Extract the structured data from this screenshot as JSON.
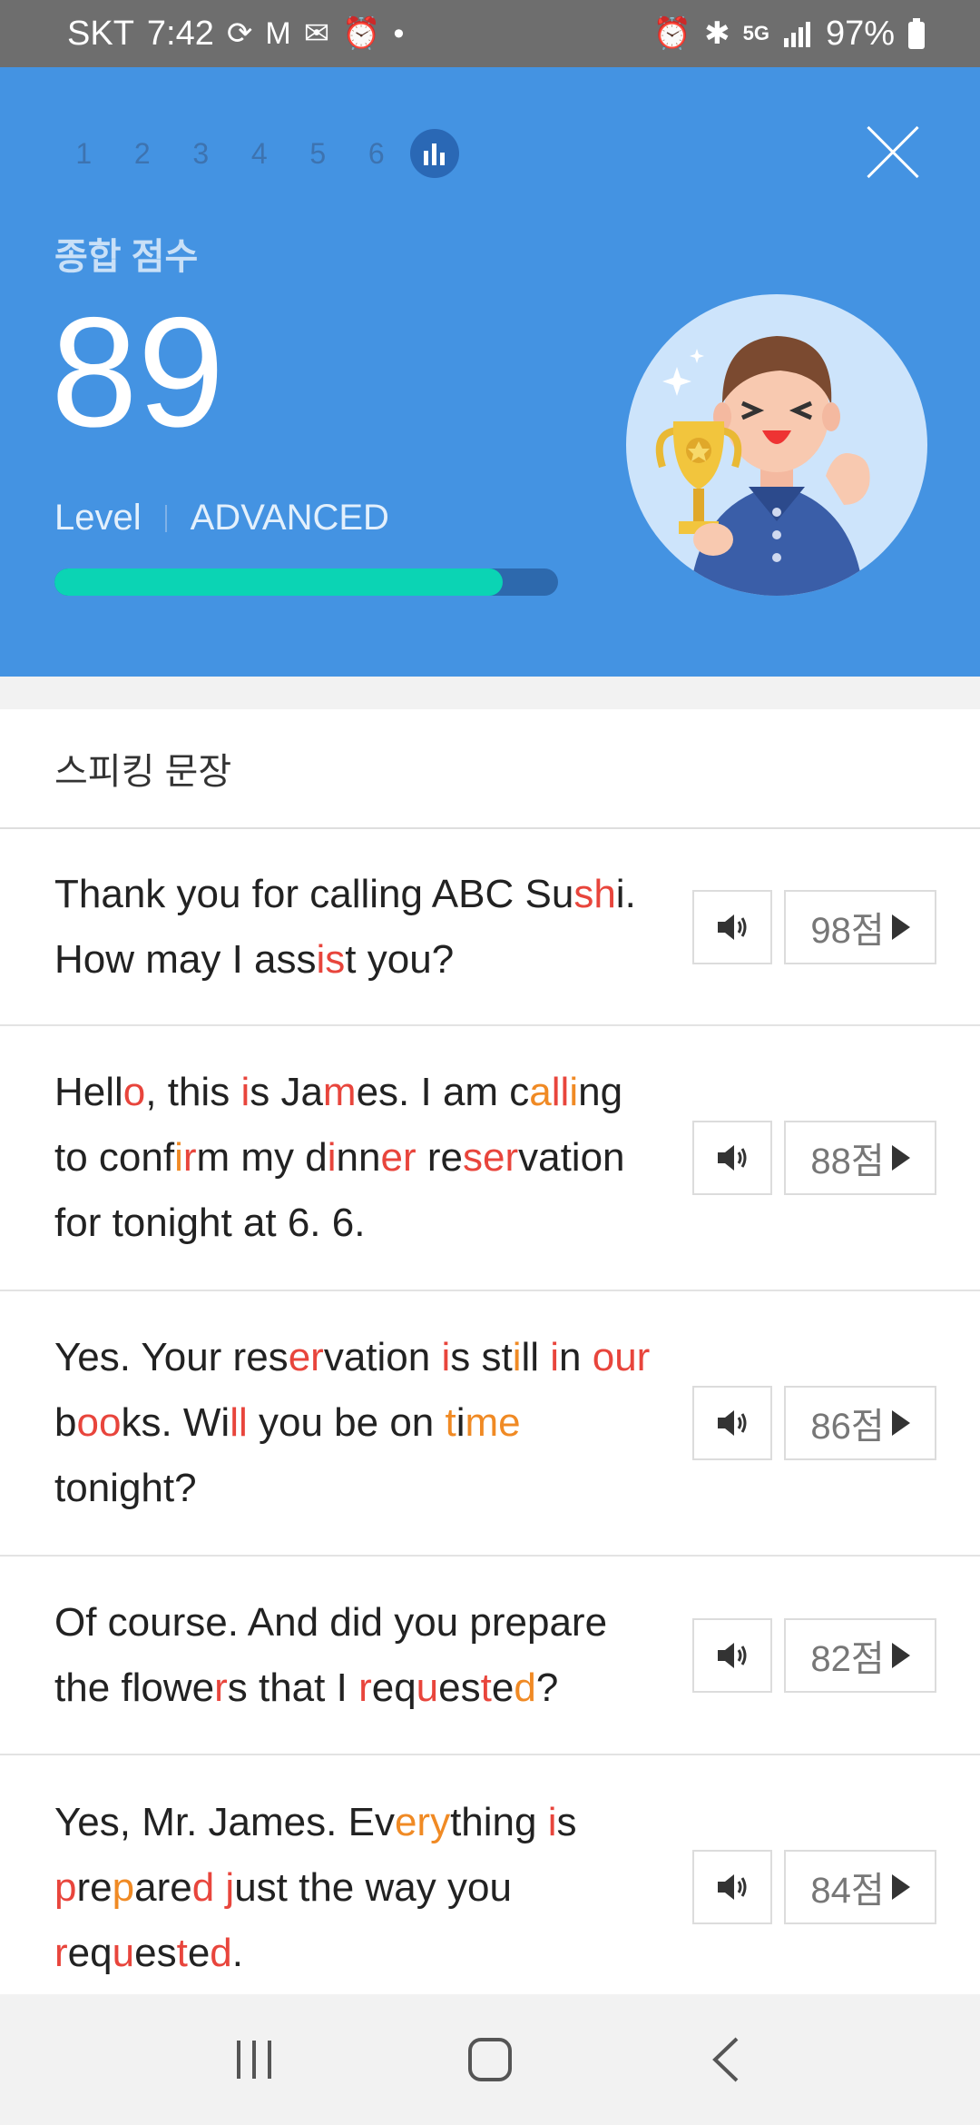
{
  "status_bar": {
    "carrier": "SKT",
    "time": "7:42",
    "battery": "97%"
  },
  "header": {
    "steps": [
      "1",
      "2",
      "3",
      "4",
      "5",
      "6"
    ],
    "score_label": "종합 점수",
    "score": "89",
    "level_label": "Level",
    "level_value": "ADVANCED",
    "progress_fraction": 0.89,
    "colors": {
      "background": "#4493e2",
      "progress_fill": "#0bd4b4",
      "progress_track": "#2d69ad"
    }
  },
  "list": {
    "title": "스피킹 문장",
    "sentences": [
      {
        "score": "98점"
      },
      {
        "score": "88점"
      },
      {
        "score": "86점"
      },
      {
        "score": "82점"
      },
      {
        "score": "84점"
      }
    ],
    "colors": {
      "error": "#e8453c",
      "warning": "#f08a24"
    }
  },
  "icons": [
    "speaker-icon",
    "play-icon",
    "close-icon",
    "bar-chart-icon",
    "trophy-icon",
    "recents-icon",
    "home-icon",
    "back-icon"
  ]
}
